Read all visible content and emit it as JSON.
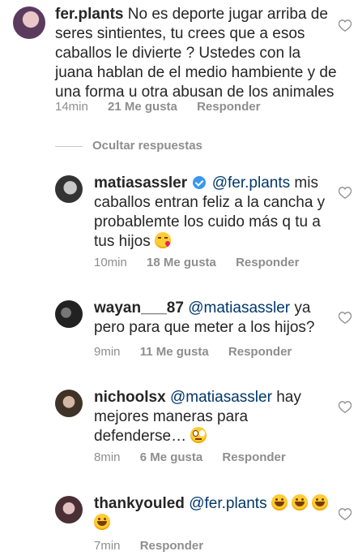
{
  "comments": [
    {
      "user": "fer.plants",
      "text": "No es deporte jugar arriba de seres sintientes, tu crees que a esos caballos le divierte ? Ustedes con la juana hablan de el medio hambiente y de una forma u otra abusan de los animales",
      "time": "14min",
      "likes": "21 Me gusta",
      "reply": "Responder"
    },
    {
      "user": "matiasassler",
      "verified": true,
      "mention": "@fer.plants",
      "text": "mis caballos entran feliz a la cancha y probablemte los cuido más q tu a tus hijos",
      "emoji": "kiss-face-emoji",
      "time": "10min",
      "likes": "18 Me gusta",
      "reply": "Responder"
    },
    {
      "user": "wayan___87",
      "mention": "@matiasassler",
      "text": "ya pero para que meter a los hijos?",
      "time": "9min",
      "likes": "11 Me gusta",
      "reply": "Responder"
    },
    {
      "user": "nichoolsx",
      "mention": "@matiasassler",
      "text": "hay mejores maneras para defenderse…",
      "emoji": "eye-roll-emoji",
      "time": "8min",
      "likes": "6 Me gusta",
      "reply": "Responder"
    },
    {
      "user": "thankyouled",
      "mention": "@fer.plants",
      "emoji": "grinning-emoji x4",
      "time": "7min",
      "reply": "Responder"
    }
  ],
  "replies_toggle": "Ocultar respuestas",
  "colors": {
    "text": "#262626",
    "meta": "#8e8e8e",
    "mention": "#00376b",
    "verified": "#3897f0"
  }
}
